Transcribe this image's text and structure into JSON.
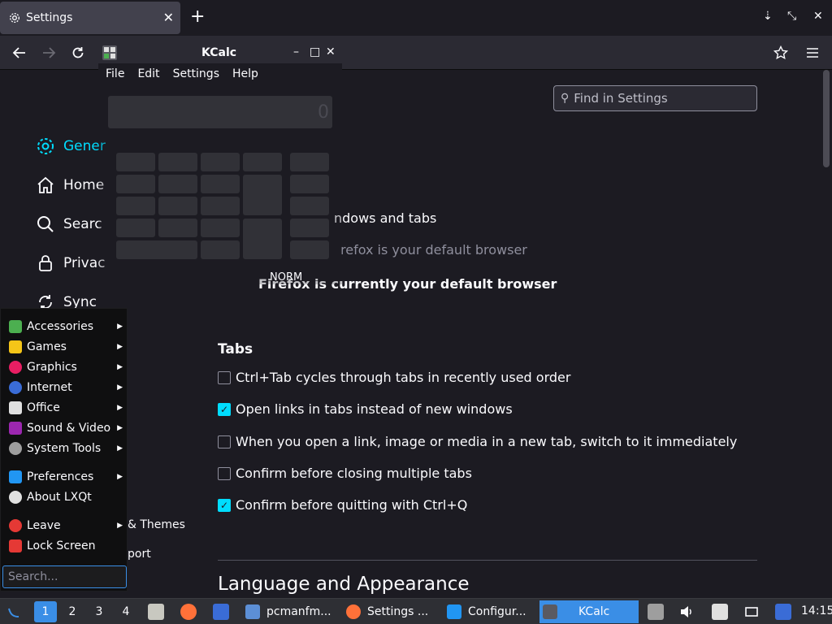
{
  "browser": {
    "tab_title": "Settings",
    "tab_close": "✕",
    "new_tab": "+",
    "win_min": "⇣",
    "win_restore": "⤡",
    "win_close": "✕"
  },
  "settings": {
    "find_placeholder": "Find in Settings",
    "sidebar": [
      {
        "label": "Gener",
        "icon": "gear-icon",
        "active": true
      },
      {
        "label": "Home",
        "icon": "home-icon"
      },
      {
        "label": "Searc",
        "icon": "search-icon"
      },
      {
        "label": "Privac",
        "icon": "lock-icon"
      },
      {
        "label": "Sync",
        "icon": "sync-icon"
      }
    ],
    "sidebar_lower": [
      {
        "label": "& Themes"
      },
      {
        "label": "port"
      }
    ],
    "startup_partial": "ndows and tabs",
    "default_partial": "refox is your default browser",
    "default_status": "Firefox is currently your default browser",
    "tabs_title": "Tabs",
    "tab_options": [
      {
        "label": "Ctrl+Tab cycles through tabs in recently used order",
        "checked": false
      },
      {
        "label": "Open links in tabs instead of new windows",
        "checked": true
      },
      {
        "label": "When you open a link, image or media in a new tab, switch to it immediately",
        "checked": false
      },
      {
        "label": "Confirm before closing multiple tabs",
        "checked": false
      },
      {
        "label": "Confirm before quitting with Ctrl+Q",
        "checked": true
      }
    ],
    "language_heading": "Language and Appearance"
  },
  "kcalc": {
    "title": "KCalc",
    "menu": [
      "File",
      "Edit",
      "Settings",
      "Help"
    ],
    "display": "0",
    "mode": "NORM",
    "ctl_min": "–",
    "ctl_max": "□",
    "ctl_close": "✕"
  },
  "start_menu": {
    "items": [
      {
        "label": "Accessories",
        "submenu": true,
        "color": "#4caf50"
      },
      {
        "label": "Games",
        "submenu": true,
        "color": "#f5c518"
      },
      {
        "label": "Graphics",
        "submenu": true,
        "color": "#e91e63"
      },
      {
        "label": "Internet",
        "submenu": true,
        "color": "#3a6cd6"
      },
      {
        "label": "Office",
        "submenu": true,
        "color": "#e0e0e0"
      },
      {
        "label": "Sound & Video",
        "submenu": true,
        "color": "#9c27b0"
      },
      {
        "label": "System Tools",
        "submenu": true,
        "color": "#9e9e9e"
      },
      {
        "label": "Preferences",
        "submenu": true,
        "color": "#2196f3"
      },
      {
        "label": "About LXQt",
        "submenu": false,
        "color": "#e0e0e0"
      },
      {
        "label": "Leave",
        "submenu": true,
        "color": "#e53935"
      },
      {
        "label": "Lock Screen",
        "submenu": false,
        "color": "#e53935"
      }
    ],
    "search_placeholder": "Search..."
  },
  "taskbar": {
    "workspaces": [
      "1",
      "2",
      "3",
      "4"
    ],
    "tasks": [
      {
        "label": "pcmanfm...",
        "active": false
      },
      {
        "label": "Settings ...",
        "active": false
      },
      {
        "label": "Configur...",
        "active": false
      },
      {
        "label": "KCalc",
        "active": true
      }
    ],
    "clock": "14:15"
  }
}
